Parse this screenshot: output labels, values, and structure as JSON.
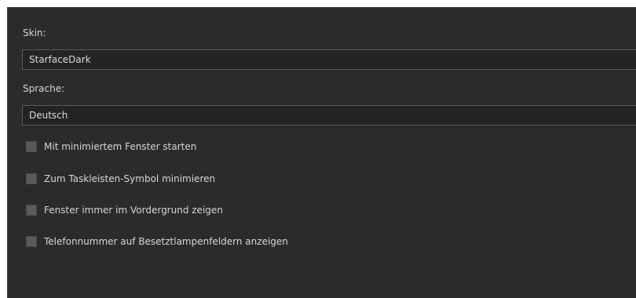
{
  "settings": {
    "skin_label": "Skin:",
    "skin_value": "StarfaceDark",
    "language_label": "Sprache:",
    "language_value": "Deutsch",
    "checkboxes": [
      {
        "label": "Mit minimiertem Fenster starten",
        "checked": false
      },
      {
        "label": "Zum Taskleisten-Symbol minimieren",
        "checked": false
      },
      {
        "label": "Fenster immer im Vordergrund zeigen",
        "checked": false
      },
      {
        "label": "Telefonnummer auf Besetztlampenfeldern anzeigen",
        "checked": false
      }
    ]
  },
  "colors": {
    "panel_background": "#2b2b2b",
    "field_background": "#242424",
    "text": "#d6d6d6",
    "checkbox": "#5a5a5a"
  }
}
